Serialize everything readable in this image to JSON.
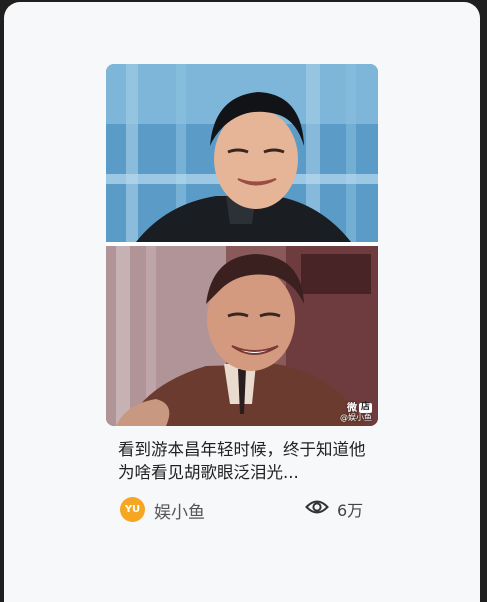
{
  "post": {
    "title": "看到游本昌年轻时候，终于知道他为啥看见胡歌眼泛泪光...",
    "author": "娱小鱼",
    "avatar_text": "YU",
    "avatar_color": "#f5a623",
    "views": "6万",
    "view_icon": "eye-icon"
  },
  "image": {
    "watermark_brand": "微",
    "watermark_box": "店",
    "watermark_handle": "@娱小鱼"
  }
}
